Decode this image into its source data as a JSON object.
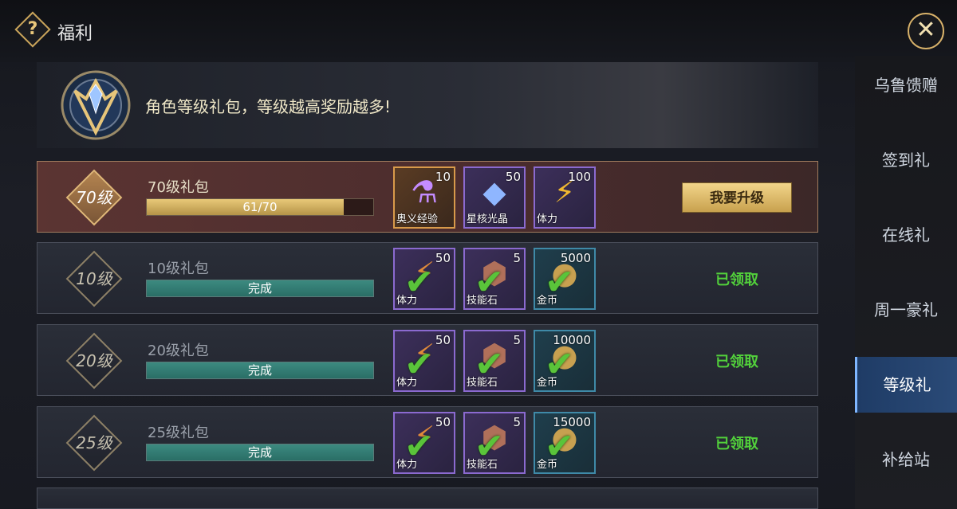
{
  "header": {
    "title": "福利",
    "help_icon": "?",
    "close_icon": "✕"
  },
  "banner": {
    "text": "角色等级礼包，等级越高奖励越多!"
  },
  "sidebar": {
    "items": [
      {
        "label": "乌鲁馈赠",
        "active": false
      },
      {
        "label": "签到礼",
        "active": false
      },
      {
        "label": "在线礼",
        "active": false
      },
      {
        "label": "周一豪礼",
        "active": false
      },
      {
        "label": "等级礼",
        "active": true
      },
      {
        "label": "补给站",
        "active": false
      }
    ]
  },
  "rows": [
    {
      "level": "70级",
      "name": "70级礼包",
      "progress_text": "61/70",
      "progress": 0.871,
      "items": [
        {
          "qty": "10",
          "name": "奥义经验",
          "icon": "potion-icon"
        },
        {
          "qty": "50",
          "name": "星核光晶",
          "icon": "crystal-icon"
        },
        {
          "qty": "100",
          "name": "体力",
          "icon": "lightning-icon"
        }
      ],
      "action": "我要升级"
    },
    {
      "level": "10级",
      "name": "10级礼包",
      "progress_text": "完成",
      "progress": 1,
      "items": [
        {
          "qty": "50",
          "name": "体力",
          "icon": "stamina-icon"
        },
        {
          "qty": "5",
          "name": "技能石",
          "icon": "skill-stone-icon"
        },
        {
          "qty": "5000",
          "name": "金币",
          "icon": "gold-coin-icon"
        }
      ],
      "status": "已领取"
    },
    {
      "level": "20级",
      "name": "20级礼包",
      "progress_text": "完成",
      "progress": 1,
      "items": [
        {
          "qty": "50",
          "name": "体力",
          "icon": "stamina-icon"
        },
        {
          "qty": "5",
          "name": "技能石",
          "icon": "skill-stone-icon"
        },
        {
          "qty": "10000",
          "name": "金币",
          "icon": "gold-coin-icon"
        }
      ],
      "status": "已领取"
    },
    {
      "level": "25级",
      "name": "25级礼包",
      "progress_text": "完成",
      "progress": 1,
      "items": [
        {
          "qty": "50",
          "name": "体力",
          "icon": "stamina-icon"
        },
        {
          "qty": "5",
          "name": "技能石",
          "icon": "skill-stone-icon"
        },
        {
          "qty": "15000",
          "name": "金币",
          "icon": "gold-coin-icon"
        }
      ],
      "status": "已领取"
    }
  ],
  "colors": {
    "accent_gold": "#c9a45a",
    "claimed_green": "#52d13b",
    "active_tab": "#2a4a77"
  }
}
